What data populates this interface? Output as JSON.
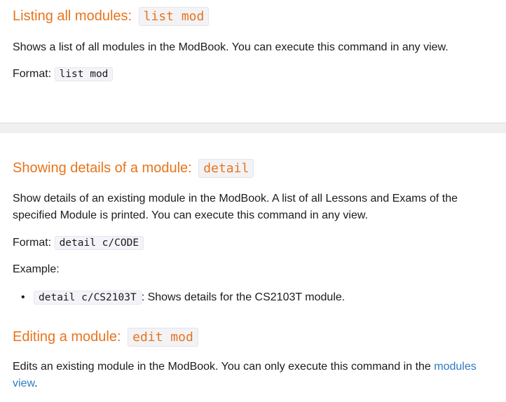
{
  "sections": [
    {
      "title": "Listing all modules: ",
      "command": "list mod",
      "description": "Shows a list of all modules in the ModBook. You can execute this command in any view.",
      "format_label": "Format: ",
      "format_code": "list mod"
    },
    {
      "title": "Showing details of a module: ",
      "command": "detail",
      "description": "Show details of an existing module in the ModBook. A list of all Lessons and Exams of the specified Module is printed. You can execute this command in any view.",
      "format_label": "Format: ",
      "format_code": "detail c/CODE",
      "example_label": "Example:",
      "examples": [
        {
          "code": "detail c/CS2103T",
          "text": ": Shows details for the CS2103T module."
        }
      ]
    },
    {
      "title": "Editing a module: ",
      "command": "edit mod",
      "description": "Edits an existing module in the ModBook. You can only execute this command in the ",
      "link_text": "modules view",
      "description_end": "."
    }
  ],
  "colors": {
    "heading": "#e8741c",
    "link": "#2e7bc4",
    "text": "#1b1b1b"
  }
}
